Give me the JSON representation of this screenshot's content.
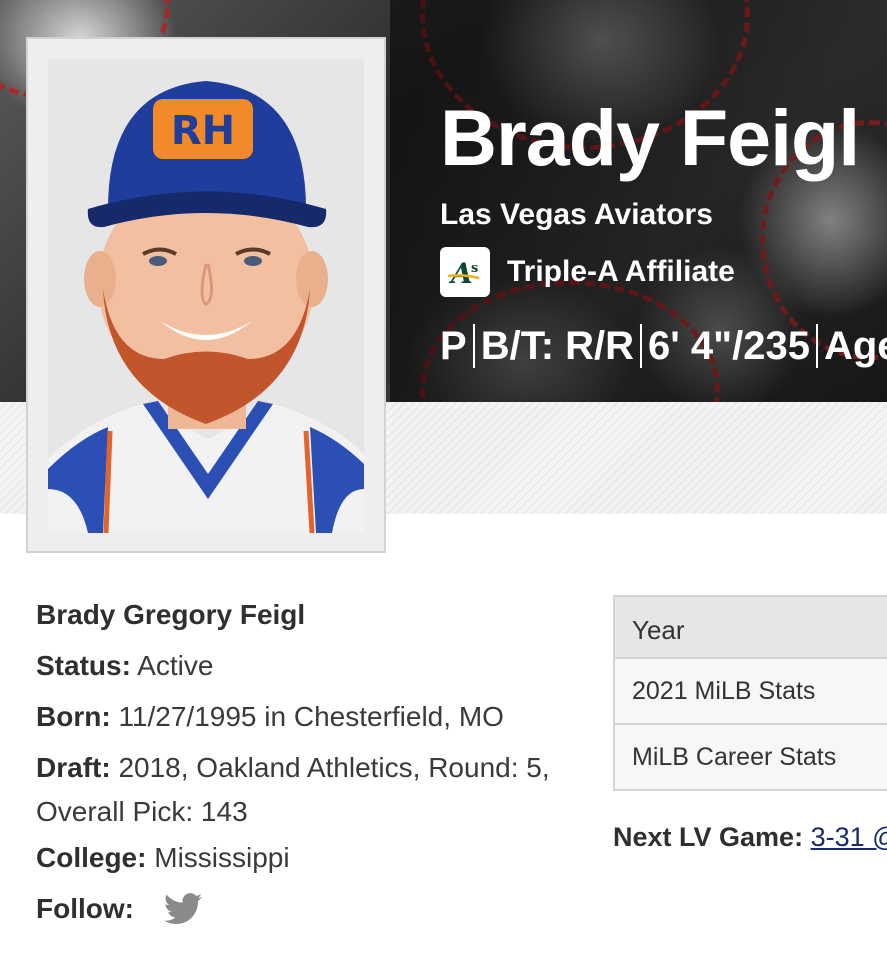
{
  "player": {
    "name": "Brady Feigl",
    "team": "Las Vegas Aviators",
    "affiliate_label": "Triple-A Affiliate",
    "affiliate_logo_icon": "athletics-logo-icon",
    "vitals": {
      "position": "P",
      "bats_throws": "B/T: R/R",
      "height_weight": "6' 4\"/235",
      "age": "Age"
    }
  },
  "bio": {
    "full_name": "Brady Gregory Feigl",
    "status_label": "Status:",
    "status_value": "Active",
    "born_label": "Born:",
    "born_value": "11/27/1995 in Chesterfield, MO",
    "draft_label": "Draft:",
    "draft_value": "2018, Oakland Athletics, Round: 5, Overall Pick: 143",
    "college_label": "College:",
    "college_value": "Mississippi",
    "follow_label": "Follow:",
    "follow_icon": "twitter-icon"
  },
  "stats_table": {
    "header": "Year",
    "rows": [
      "2021 MiLB Stats",
      "MiLB Career Stats"
    ]
  },
  "next_game": {
    "label": "Next LV Game:",
    "link_text": "3-31 @"
  },
  "colors": {
    "cap_blue": "#1f3d9c",
    "beard": "#c2552b",
    "link": "#1a2a6c",
    "athletics_green": "#0b4a2e"
  }
}
